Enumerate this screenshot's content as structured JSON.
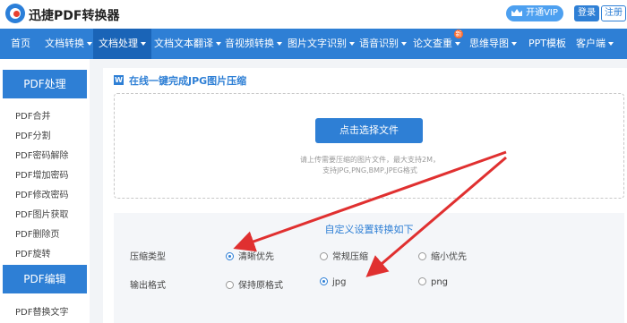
{
  "header": {
    "logo_text": "迅捷PDF转换器",
    "vip_label": "开通VIP",
    "login_label": "登录",
    "register_label": "注册"
  },
  "nav": {
    "items": [
      {
        "label": "首页"
      },
      {
        "label": "文档转换"
      },
      {
        "label": "文档处理"
      },
      {
        "label": "文档文本翻译"
      },
      {
        "label": "音视频转换"
      },
      {
        "label": "图片文字识别"
      },
      {
        "label": "语音识别"
      },
      {
        "label": "论文查重"
      },
      {
        "label": "思维导图"
      },
      {
        "label": "PPT模板"
      },
      {
        "label": "客户端"
      }
    ],
    "badge": "新"
  },
  "sidebar": {
    "section1_title": "PDF处理",
    "section1_items": [
      "PDF合并",
      "PDF分割",
      "PDF密码解除",
      "PDF增加密码",
      "PDF修改密码",
      "PDF图片获取",
      "PDF删除页",
      "PDF旋转"
    ],
    "section2_title": "PDF编辑",
    "section2_items": [
      "PDF替换文字"
    ]
  },
  "main": {
    "title_icon": "W",
    "title": "在线一键完成JPG图片压缩",
    "select_button": "点击选择文件",
    "hint_line1": "请上传需要压缩的图片文件，最大支持2M，",
    "hint_line2": "支持JPG,PNG,BMP,JPEG格式",
    "settings_title": "自定义设置转换如下",
    "compress_label": "压缩类型",
    "compress_options": [
      "清晰优先",
      "常规压缩",
      "缩小优先"
    ],
    "compress_selected": "清晰优先",
    "format_label": "输出格式",
    "format_options": [
      "保持原格式",
      "jpg",
      "png"
    ],
    "format_selected": "jpg"
  },
  "colors": {
    "accent": "#2e7fd5",
    "annotation_arrow": "#e03030"
  },
  "icons": [
    "logo-icon",
    "crown-icon",
    "caret-down-icon",
    "word-doc-icon",
    "radio-icon"
  ]
}
